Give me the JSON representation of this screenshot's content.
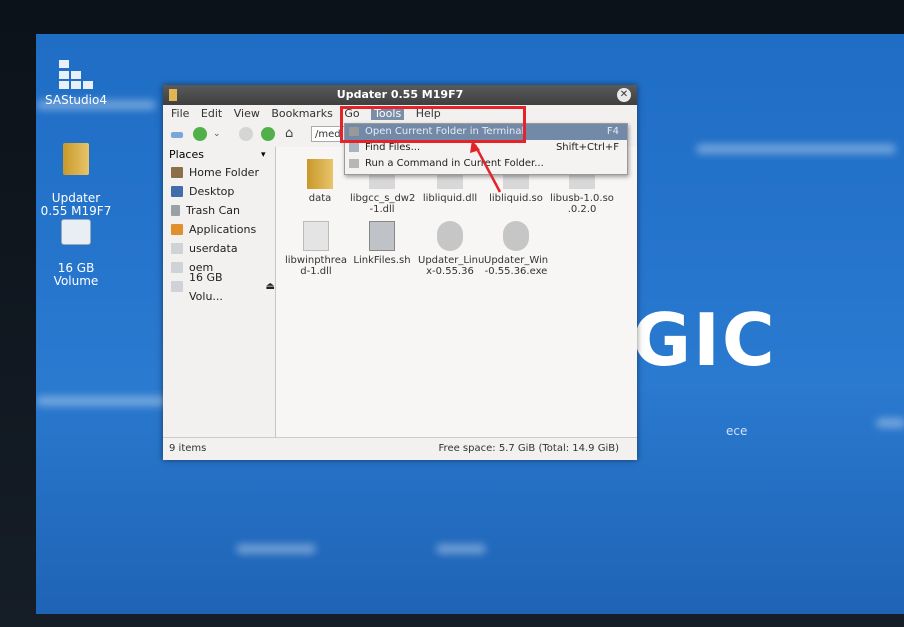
{
  "desktop": {
    "icons": [
      {
        "label": "SAStudio4"
      },
      {
        "label": "Updater\n0.55 M19F7"
      },
      {
        "label": "16 GB\nVolume"
      }
    ],
    "background_text": "GIC",
    "background_subtext": "ece"
  },
  "window": {
    "title": "Updater 0.55 M19F7",
    "menu": [
      "File",
      "Edit",
      "View",
      "Bookmarks",
      "Go",
      "Tools",
      "Help"
    ],
    "location_text": "/med",
    "sidebar": {
      "header": "Places",
      "items": [
        "Home Folder",
        "Desktop",
        "Trash Can",
        "Applications",
        "userdata",
        "oem",
        "16 GB Volu..."
      ]
    },
    "files": [
      {
        "name": "data"
      },
      {
        "name": "libgcc_s_dw2\n-1.dll"
      },
      {
        "name": "libliquid.dll"
      },
      {
        "name": "libliquid.so"
      },
      {
        "name": "libusb-1.0.so\n.0.2.0"
      },
      {
        "name": "libwinpthrea\nd-1.dll"
      },
      {
        "name": "LinkFiles.sh"
      },
      {
        "name": "Updater_Linu\nx-0.55.36"
      },
      {
        "name": "Updater_Win\n-0.55.36.exe"
      }
    ],
    "status_left": "9 items",
    "status_right": "Free space: 5.7 GiB (Total: 14.9 GiB)"
  },
  "tools_menu": {
    "items": [
      {
        "label": "Open Current Folder in Terminal",
        "accel": "F4"
      },
      {
        "label": "Find Files...",
        "accel": "Shift+Ctrl+F"
      },
      {
        "label": "Run a Command in Current Folder...",
        "accel": ""
      }
    ]
  },
  "colors": {
    "desktop_blue": "#2574cc",
    "highlight": "#e3242b",
    "menu_highlight": "#7289a8"
  }
}
